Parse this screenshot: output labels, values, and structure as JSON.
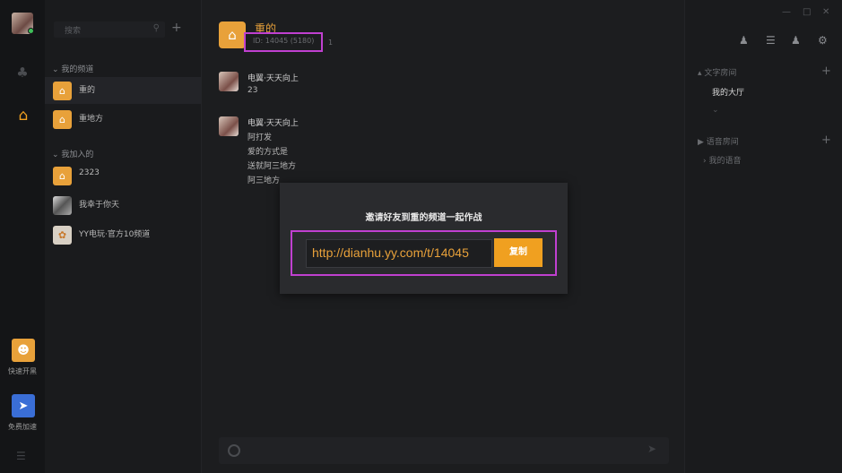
{
  "rail": {
    "quick_channel_label": "快速开黑",
    "speed_label": "免费加速"
  },
  "channel_list": {
    "search_placeholder": "搜索",
    "group_mine": "我的频道",
    "group_joined": "我加入的",
    "mine_items": [
      {
        "label": "重的"
      },
      {
        "label": "重地方"
      }
    ],
    "joined_items": [
      {
        "label": "2323"
      },
      {
        "label": "我幸于你天"
      },
      {
        "label": "YY电玩·官方10频道"
      }
    ]
  },
  "chat": {
    "title": "重的",
    "channel_id": "ID: 14045 (5180)",
    "member_count": "1",
    "messages": [
      {
        "name": "电翼·天天向上",
        "lines": [
          "23"
        ]
      },
      {
        "name": "电翼·天天向上",
        "lines": [
          "阿打发",
          "爱的方式是",
          "送就阿三地方",
          "阿三地方"
        ]
      }
    ]
  },
  "right_panel": {
    "text_section": "文字房间",
    "text_rooms": [
      "我的大厅"
    ],
    "voice_section": "语音房间",
    "voice_rooms": [
      "我的语音"
    ]
  },
  "modal": {
    "title": "邀请好友到重的频道一起作战",
    "url": "http://dianhu.yy.com/t/14045",
    "copy_label": "复制"
  },
  "colors": {
    "accent": "#f0a020",
    "highlight": "#c040d0"
  }
}
